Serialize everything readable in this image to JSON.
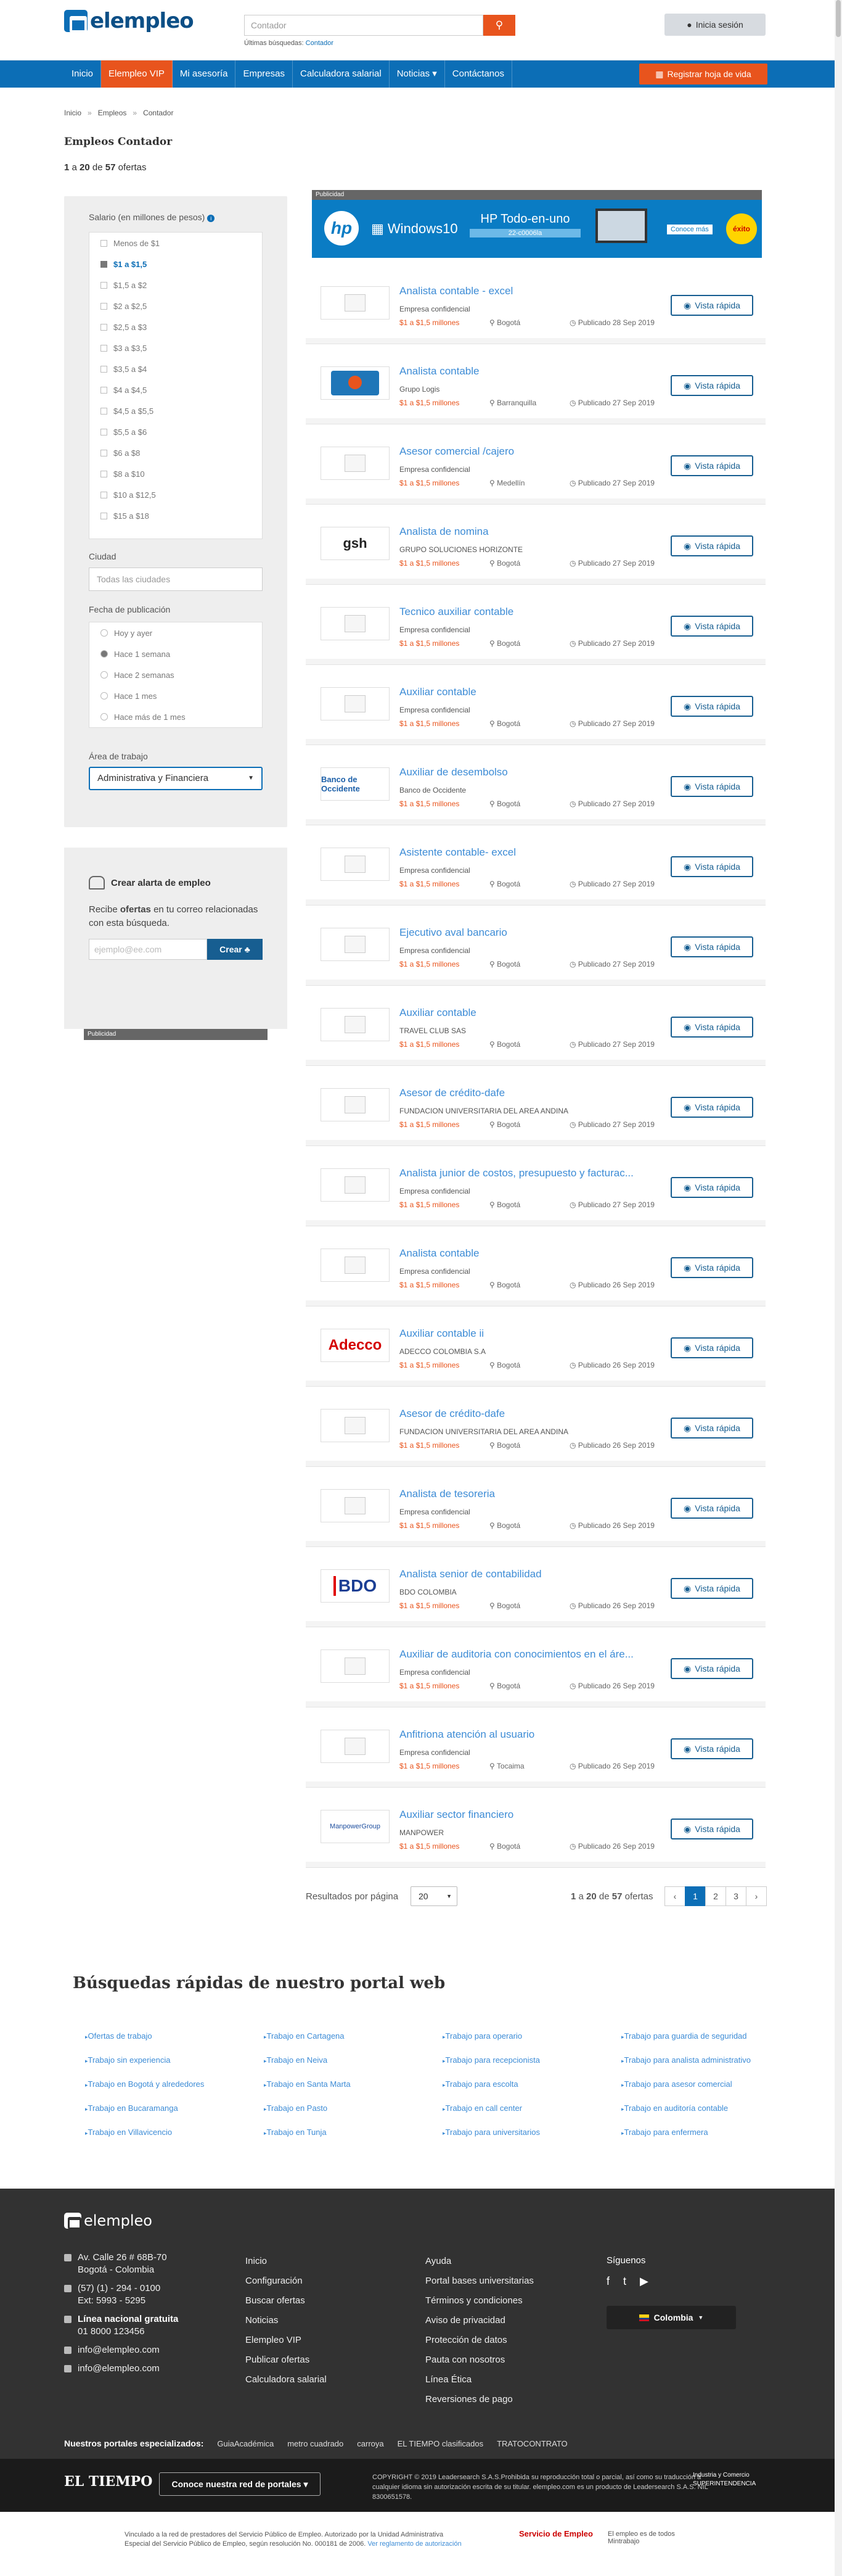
{
  "header": {
    "logo": "elempleo",
    "search_placeholder": "Contador",
    "recent_label": "Últimas búsquedas:",
    "recent_value": "Contador",
    "login": "Inicia sesión"
  },
  "nav": {
    "items": [
      "Inicio",
      "Elempleo VIP",
      "Mi asesoría",
      "Empresas",
      "Calculadora salarial",
      "Noticias ▾",
      "Contáctanos"
    ],
    "active_index": 1,
    "register": "Registrar hoja de vida"
  },
  "breadcrumb": [
    "Inicio",
    "Empleos",
    "Contador"
  ],
  "page": {
    "title": "Empleos Contador",
    "count_from": "1",
    "count_a": "a",
    "count_to": "20",
    "count_de": "de",
    "count_total": "57",
    "count_suffix": "ofertas"
  },
  "filters": {
    "salary_title": "Salario (en millones de pesos)",
    "salary_options": [
      "Menos de $1",
      "$1 a $1,5",
      "$1,5 a $2",
      "$2 a $2,5",
      "$2,5 a $3",
      "$3 a $3,5",
      "$3,5 a $4",
      "$4 a $4,5",
      "$4,5 a $5,5",
      "$5,5 a $6",
      "$6 a $8",
      "$8 a $10",
      "$10 a $12,5",
      "$15 a $18"
    ],
    "salary_selected": 1,
    "city_title": "Ciudad",
    "city_placeholder": "Todas las ciudades",
    "date_title": "Fecha de publicación",
    "date_options": [
      "Hoy y ayer",
      "Hace 1 semana",
      "Hace 2 semanas",
      "Hace 1 mes",
      "Hace más de 1 mes"
    ],
    "date_selected": 1,
    "area_title": "Área de trabajo",
    "area_value": "Administrativa y Financiera"
  },
  "alert": {
    "title": "Crear alarta de empleo",
    "desc_1": "Recibe",
    "desc_bold": "ofertas",
    "desc_2": "en tu correo relacionadas con esta búsqueda.",
    "email_placeholder": "ejemplo@ee.com",
    "button": "Crear"
  },
  "ads": {
    "label": "Publicidad",
    "brand": "hp",
    "os": "Windows10",
    "product": "HP Todo-en-uno",
    "product_sub": "22-c0006la",
    "cta": "Conoce más",
    "badge": "éxito"
  },
  "jobs": [
    {
      "title": "Analista contable - excel",
      "company": "Empresa confidencial",
      "salary": "$1 a $1,5 millones",
      "city": "Bogotá",
      "date": "Publicado 28 Sep 2019",
      "logo": "placeholder"
    },
    {
      "title": "Analista contable",
      "company": "Grupo Logis",
      "salary": "$1 a $1,5 millones",
      "city": "Barranquilla",
      "date": "Publicado 27 Sep 2019",
      "logo": "grupo-logis"
    },
    {
      "title": "Asesor comercial /cajero",
      "company": "Empresa confidencial",
      "salary": "$1 a $1,5 millones",
      "city": "Medellín",
      "date": "Publicado 27 Sep 2019",
      "logo": "placeholder"
    },
    {
      "title": "Analista de nomina",
      "company": "GRUPO SOLUCIONES HORIZONTE",
      "salary": "$1 a $1,5 millones",
      "city": "Bogotá",
      "date": "Publicado 27 Sep 2019",
      "logo": "gsh"
    },
    {
      "title": "Tecnico auxiliar contable",
      "company": "Empresa confidencial",
      "salary": "$1 a $1,5 millones",
      "city": "Bogotá",
      "date": "Publicado 27 Sep 2019",
      "logo": "placeholder"
    },
    {
      "title": "Auxiliar contable",
      "company": "Empresa confidencial",
      "salary": "$1 a $1,5 millones",
      "city": "Bogotá",
      "date": "Publicado 27 Sep 2019",
      "logo": "placeholder"
    },
    {
      "title": "Auxiliar de desembolso",
      "company": "Banco de Occidente",
      "salary": "$1 a $1,5 millones",
      "city": "Bogotá",
      "date": "Publicado 27 Sep 2019",
      "logo": "banco-occidente"
    },
    {
      "title": "Asistente contable- excel",
      "company": "Empresa confidencial",
      "salary": "$1 a $1,5 millones",
      "city": "Bogotá",
      "date": "Publicado 27 Sep 2019",
      "logo": "placeholder"
    },
    {
      "title": "Ejecutivo aval bancario",
      "company": "Empresa confidencial",
      "salary": "$1 a $1,5 millones",
      "city": "Bogotá",
      "date": "Publicado 27 Sep 2019",
      "logo": "placeholder"
    },
    {
      "title": "Auxiliar contable",
      "company": "TRAVEL CLUB SAS",
      "salary": "$1 a $1,5 millones",
      "city": "Bogotá",
      "date": "Publicado 27 Sep 2019",
      "logo": "placeholder"
    },
    {
      "title": "Asesor de crédito-dafe",
      "company": "FUNDACION UNIVERSITARIA DEL AREA ANDINA",
      "salary": "$1 a $1,5 millones",
      "city": "Bogotá",
      "date": "Publicado 27 Sep 2019",
      "logo": "placeholder"
    },
    {
      "title": "Analista junior de costos, presupuesto y facturac...",
      "company": "Empresa confidencial",
      "salary": "$1 a $1,5 millones",
      "city": "Bogotá",
      "date": "Publicado 27 Sep 2019",
      "logo": "placeholder"
    },
    {
      "title": "Analista contable",
      "company": "Empresa confidencial",
      "salary": "$1 a $1,5 millones",
      "city": "Bogotá",
      "date": "Publicado 26 Sep 2019",
      "logo": "placeholder"
    },
    {
      "title": "Auxiliar contable ii",
      "company": "ADECCO COLOMBIA S.A",
      "salary": "$1 a $1,5 millones",
      "city": "Bogotá",
      "date": "Publicado 26 Sep 2019",
      "logo": "adecco"
    },
    {
      "title": "Asesor de crédito-dafe",
      "company": "FUNDACION UNIVERSITARIA DEL AREA ANDINA",
      "salary": "$1 a $1,5 millones",
      "city": "Bogotá",
      "date": "Publicado 26 Sep 2019",
      "logo": "placeholder"
    },
    {
      "title": "Analista de tesoreria",
      "company": "Empresa confidencial",
      "salary": "$1 a $1,5 millones",
      "city": "Bogotá",
      "date": "Publicado 26 Sep 2019",
      "logo": "placeholder"
    },
    {
      "title": "Analista senior de contabilidad",
      "company": "BDO COLOMBIA",
      "salary": "$1 a $1,5 millones",
      "city": "Bogotá",
      "date": "Publicado 26 Sep 2019",
      "logo": "bdo"
    },
    {
      "title": "Auxiliar de auditoria con conocimientos en el áre...",
      "company": "Empresa confidencial",
      "salary": "$1 a $1,5 millones",
      "city": "Bogotá",
      "date": "Publicado 26 Sep 2019",
      "logo": "placeholder"
    },
    {
      "title": "Anfitriona atención al usuario",
      "company": "Empresa confidencial",
      "salary": "$1 a $1,5 millones",
      "city": "Tocaima",
      "date": "Publicado 26 Sep 2019",
      "logo": "placeholder"
    },
    {
      "title": "Auxiliar sector financiero",
      "company": "MANPOWER",
      "salary": "$1 a $1,5 millones",
      "city": "Bogotá",
      "date": "Publicado 26 Sep 2019",
      "logo": "manpower"
    }
  ],
  "job_button": "Vista rápida",
  "pagination": {
    "per_page_label": "Resultados por página",
    "per_page": "20",
    "pages": [
      "‹",
      "1",
      "2",
      "3",
      "›"
    ],
    "active_page": "1"
  },
  "quick": {
    "title": "Búsquedas rápidas de nuestro portal web",
    "links": [
      "Ofertas de trabajo",
      "Trabajo en Cartagena",
      "Trabajo para operario",
      "Trabajo para guardia de seguridad",
      "Trabajo sin experiencia",
      "Trabajo en Neiva",
      "Trabajo para recepcionista",
      "Trabajo para analista administrativo",
      "Trabajo en Bogotá y alrededores",
      "Trabajo en Santa Marta",
      "Trabajo para escolta",
      "Trabajo para asesor comercial",
      "Trabajo en Bucaramanga",
      "Trabajo en Pasto",
      "Trabajo en call center",
      "Trabajo en auditoría contable",
      "Trabajo en Villavicencio",
      "Trabajo en Tunja",
      "Trabajo para universitarios",
      "Trabajo para enfermera"
    ]
  },
  "footer": {
    "logo": "elempleo",
    "address_1": "Av. Calle 26 # 68B-70",
    "address_2": "Bogotá - Colombia",
    "phone_1": "(57) (1) - 294 - 0100",
    "phone_2": "Ext: 5993 - 5295",
    "free_line_label": "Línea nacional gratuita",
    "free_line": "01 8000 123456",
    "email_1": "info@elempleo.com",
    "email_2": "info@elempleo.com",
    "col1": [
      "Inicio",
      "Configuración",
      "Buscar ofertas",
      "Noticias",
      "Elempleo VIP",
      "Publicar ofertas",
      "Calculadora salarial"
    ],
    "col2": [
      "Ayuda",
      "Portal bases universitarias",
      "Términos y condiciones",
      "Aviso de privacidad",
      "Protección de datos",
      "Pauta con nosotros",
      "Línea Ética",
      "Reversiones de pago"
    ],
    "follow": "Síguenos",
    "social": [
      "f",
      "t",
      "▶"
    ],
    "country": "Colombia",
    "portals_label": "Nuestros portales especializados:",
    "portals": [
      "GuiaAcadémica",
      "metro cuadrado",
      "carroya",
      "EL TIEMPO clasificados",
      "TRATOCONTRATO"
    ]
  },
  "bottom": {
    "brand": "EL TIEMPO",
    "network_button": "Conoce nuestra red de portales ▾",
    "copyright": "COPYRIGHT © 2019 Leadersearch S.A.S.Prohibida su reproducción total o parcial, así como su traducción a cualquier idioma sin autorización escrita de su titular. elempleo.com es un producto de Leadersearch S.A.S. NIL 8300651578.",
    "min_logo": "Industria y Comercio SUPERINTENDENCIA",
    "legal_text": "Vinculado a la red de prestadores del Servicio Público de Empleo. Autorizado por la Unidad Administrativa Especial del Servicio Público de Empleo, según resolución No. 000181 de 2006.",
    "legal_link": "Ver reglamento de autorización",
    "seal_1": "Servicio de Empleo",
    "seal_2": "El empleo es de todos Mintrabajo"
  }
}
